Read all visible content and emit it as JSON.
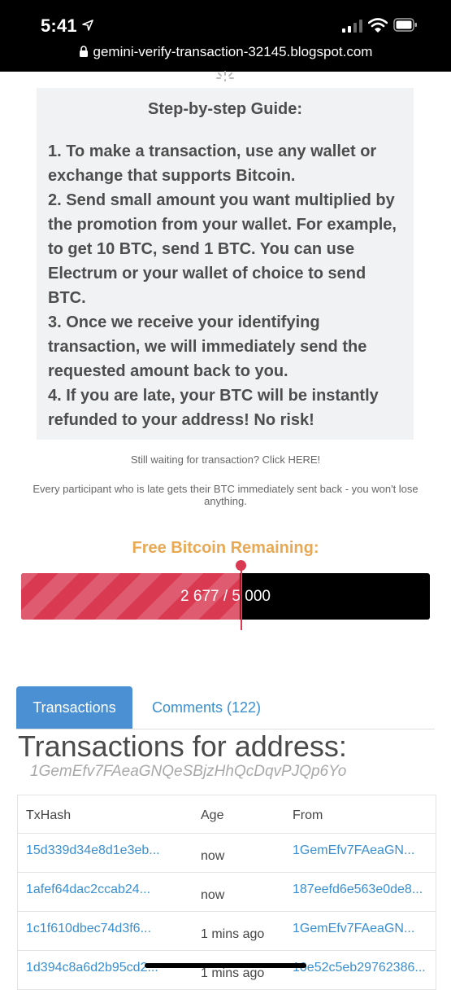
{
  "status_bar": {
    "time": "5:41"
  },
  "browser": {
    "url": "gemini-verify-transaction-32145.blogspot.com"
  },
  "guide": {
    "title": "Step-by-step Guide:",
    "steps": [
      "1. To make a transaction, use any wallet or exchange that supports Bitcoin.",
      "2. Send small amount you want multiplied by the promotion from your wallet. For example, to get 10 BTC, send 1 BTC. You can use Electrum or your wallet of choice to send BTC.",
      "3. Once we receive your identifying transaction, we will immediately send the requested amount back to you.",
      "4. If you are late, your BTC will be instantly refunded to your address! No risk!"
    ]
  },
  "waiting_text": "Still waiting for transaction? Click HERE!",
  "late_text": "Every participant who is late gets their BTC immediately sent back - you won't lose anything.",
  "progress": {
    "title": "Free Bitcoin Remaining:",
    "label": "2 677 / 5 000",
    "fraction": 0.5354
  },
  "colors": {
    "accent_orange": "#e8a854",
    "progress_red": "#d93a52",
    "link_blue": "#3a8fd0",
    "tab_blue": "#4a90d3"
  },
  "tabs": [
    {
      "label": "Transactions",
      "active": true
    },
    {
      "label": "Comments (122)",
      "active": false
    }
  ],
  "transactions": {
    "heading": "Transactions for address:",
    "address": "1GemEfv7FAeaGNQeSBjzHhQcDqvPJQp6Yo",
    "columns": [
      "TxHash",
      "Age",
      "From"
    ],
    "rows": [
      {
        "hash": "15d339d34e8d1e3eb...",
        "age": "now",
        "from": "1GemEfv7FAeaGN..."
      },
      {
        "hash": "1afef64dac2ccab24...",
        "age": "now",
        "from": "187eefd6e563e0de8..."
      },
      {
        "hash": "1c1f610dbec74d3f6...",
        "age": "1 mins ago",
        "from": "1GemEfv7FAeaGN..."
      },
      {
        "hash": "1d394c8a6d2b95cd2...",
        "age": "1 mins ago",
        "from": "10e52c5eb29762386..."
      }
    ]
  }
}
